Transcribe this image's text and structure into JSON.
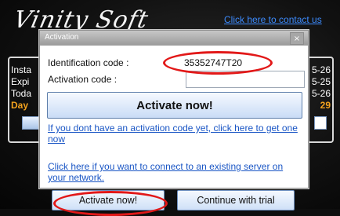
{
  "app": {
    "logo_text": "Vinity Soft",
    "contact_link": "Click here to contact us"
  },
  "info_panel": {
    "left_labels": [
      "Insta",
      "Expi",
      "Toda",
      "Day"
    ],
    "right_values": [
      "5-26",
      "5-25",
      "5-26",
      "29"
    ]
  },
  "dialog": {
    "title": "Activation",
    "close_glyph": "×",
    "identification_label": "Identification code :",
    "identification_value": "35352747T20",
    "activation_label": "Activation code :",
    "activation_input_value": "",
    "activate_button": "Activate now!",
    "no_code_link": "If you dont have an activation code yet, click here to get one now",
    "server_link": "Click here if you want to connect to an existing server on your network."
  },
  "bottom": {
    "activate_button": "Activate now!",
    "trial_button": "Continue with trial"
  },
  "colors": {
    "link": "#1a56c5",
    "highlight_ellipse": "#e21818",
    "days_accent": "#f2a21e"
  }
}
